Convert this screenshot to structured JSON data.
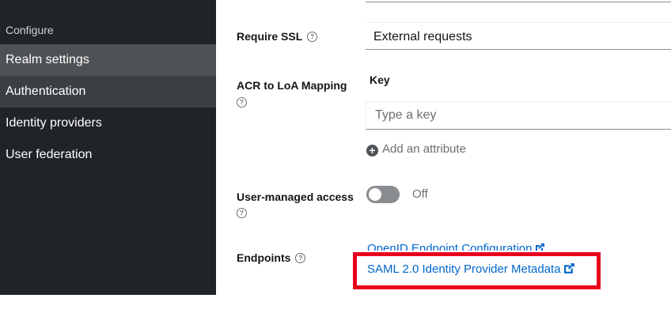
{
  "sidebar": {
    "section_label": "Configure",
    "items": [
      {
        "label": "Realm settings",
        "state": "active"
      },
      {
        "label": "Authentication",
        "state": "hover"
      },
      {
        "label": "Identity providers",
        "state": "normal"
      },
      {
        "label": "User federation",
        "state": "normal"
      }
    ]
  },
  "form": {
    "require_ssl": {
      "label": "Require SSL",
      "value": "External requests"
    },
    "acr_mapping": {
      "label": "ACR to LoA Mapping",
      "key_header": "Key",
      "key_placeholder": "Type a key",
      "add_attribute_label": "Add an attribute"
    },
    "user_managed_access": {
      "label": "User-managed access",
      "toggle_text": "Off",
      "enabled": false
    },
    "endpoints": {
      "label": "Endpoints",
      "links": [
        "OpenID Endpoint Configuration",
        "SAML 2.0 Identity Provider Metadata"
      ]
    }
  },
  "icons": {
    "help": "question-circle-icon",
    "add": "plus-circle-icon",
    "external_link": "external-link-icon"
  },
  "colors": {
    "sidebar_bg": "#212427",
    "active_item": "#4f5255",
    "link": "#0066cc",
    "highlight": "#e8001c"
  }
}
